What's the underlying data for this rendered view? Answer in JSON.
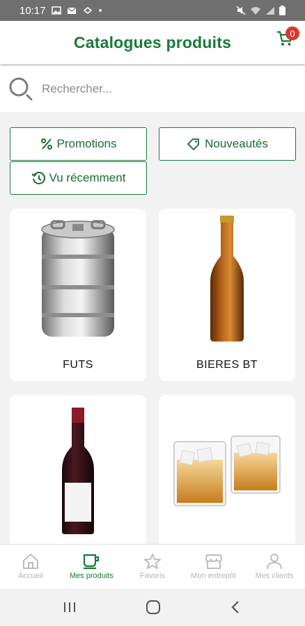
{
  "status_bar": {
    "time": "10:17",
    "dot": "•"
  },
  "header": {
    "title": "Catalogues produits",
    "cart_count": "0"
  },
  "search": {
    "placeholder": "Rechercher..."
  },
  "filters": {
    "promotions": "Promotions",
    "nouveautes": "Nouveautés",
    "recent": "Vu récemment"
  },
  "categories": [
    {
      "label": "FUTS",
      "icon": "keg"
    },
    {
      "label": "BIERES BT",
      "icon": "beer-bottle"
    },
    {
      "label": "",
      "icon": "wine-bottle"
    },
    {
      "label": "",
      "icon": "whisky-glasses"
    }
  ],
  "bottom_nav": [
    {
      "label": "Accueil",
      "icon": "home-icon"
    },
    {
      "label": "Mes produits",
      "icon": "cup-icon"
    },
    {
      "label": "Favoris",
      "icon": "star-icon"
    },
    {
      "label": "Mon entrepôt",
      "icon": "store-icon"
    },
    {
      "label": "Mes clients",
      "icon": "person-icon"
    }
  ],
  "colors": {
    "brand_green": "#1a7a3a",
    "badge_red": "#d83a2e"
  }
}
